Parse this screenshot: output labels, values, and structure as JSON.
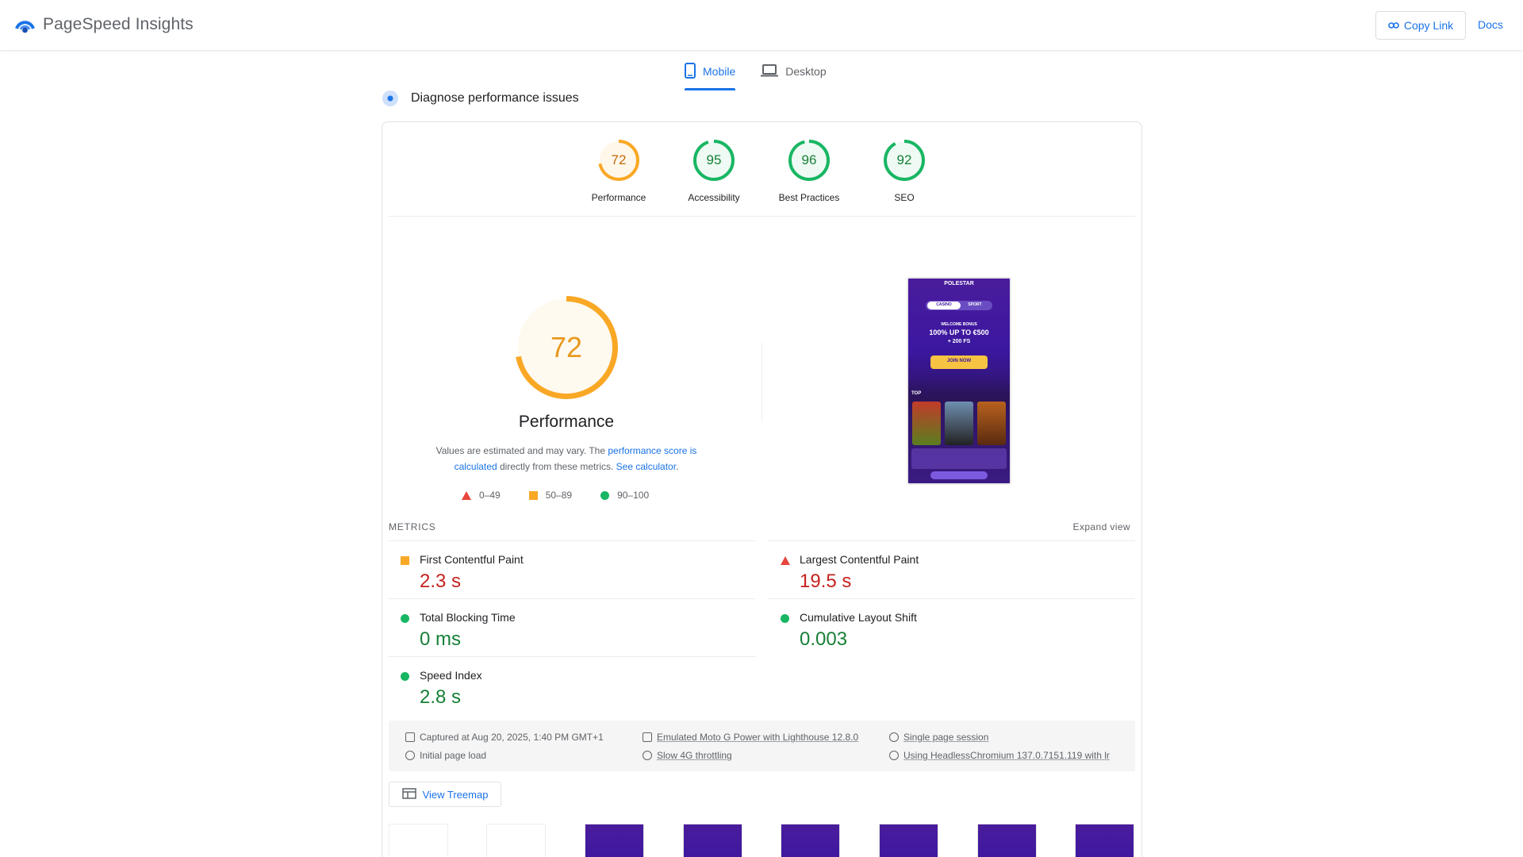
{
  "header": {
    "app_title": "PageSpeed Insights",
    "copy_link_label": "Copy Link",
    "docs_label": "Docs"
  },
  "tabs": [
    {
      "label": "Mobile",
      "active": true
    },
    {
      "label": "Desktop",
      "active": false
    }
  ],
  "section_title": "Diagnose performance issues",
  "scores": [
    {
      "value": "72",
      "label": "Performance",
      "fraction": 0.72,
      "color": "#f9a825"
    },
    {
      "value": "95",
      "label": "Accessibility",
      "fraction": 0.95,
      "color": "#18b663"
    },
    {
      "value": "96",
      "label": "Best Practices",
      "fraction": 0.96,
      "color": "#18b663"
    },
    {
      "value": "92",
      "label": "SEO",
      "fraction": 0.92,
      "color": "#18b663"
    }
  ],
  "performance": {
    "score": "72",
    "fraction": 0.72,
    "title": "Performance",
    "note_prefix": "Values are estimated and may vary. The ",
    "note_link1": "performance score is calculated",
    "note_middle": " directly from these metrics. ",
    "note_link2": "See calculator",
    "note_suffix": "."
  },
  "legend": [
    {
      "range": "0–49",
      "shape": "triangle",
      "color": "#e8453c"
    },
    {
      "range": "50–89",
      "shape": "square",
      "color": "#f9a825"
    },
    {
      "range": "90–100",
      "shape": "circle",
      "color": "#18b663"
    }
  ],
  "screenshot": {
    "brand": "POLESTAR",
    "tab_casino": "CASINO",
    "tab_sport": "SPORT",
    "welcome": "WELCOME BONUS",
    "offer": "100% UP TO €500",
    "fs": "+ 200 FS",
    "cta": "JOIN NOW",
    "top": "TOP"
  },
  "metrics_section": {
    "heading": "METRICS",
    "expand_label": "Expand view"
  },
  "metrics": [
    {
      "label": "First Contentful Paint",
      "value": "2.3 s",
      "rating": "average"
    },
    {
      "label": "Largest Contentful Paint",
      "value": "19.5 s",
      "rating": "poor"
    },
    {
      "label": "Total Blocking Time",
      "value": "0 ms",
      "rating": "good"
    },
    {
      "label": "Cumulative Layout Shift",
      "value": "0.003",
      "rating": "good"
    },
    {
      "label": "Speed Index",
      "value": "2.8 s",
      "rating": "good"
    }
  ],
  "run_info": {
    "captured": "Captured at Aug 20, 2025, 1:40 PM GMT+1",
    "load_type": "Initial page load",
    "device": "Emulated Moto G Power with Lighthouse 12.8.0",
    "throttling": "Slow 4G throttling",
    "session": "Single page session",
    "browser": "Using HeadlessChromium 137.0.7151.119 with lr"
  },
  "treemap_label": "View Treemap",
  "colors": {
    "accent": "#1a73e8",
    "average": "#f9a825",
    "good": "#18b663",
    "poor": "#e8453c"
  }
}
